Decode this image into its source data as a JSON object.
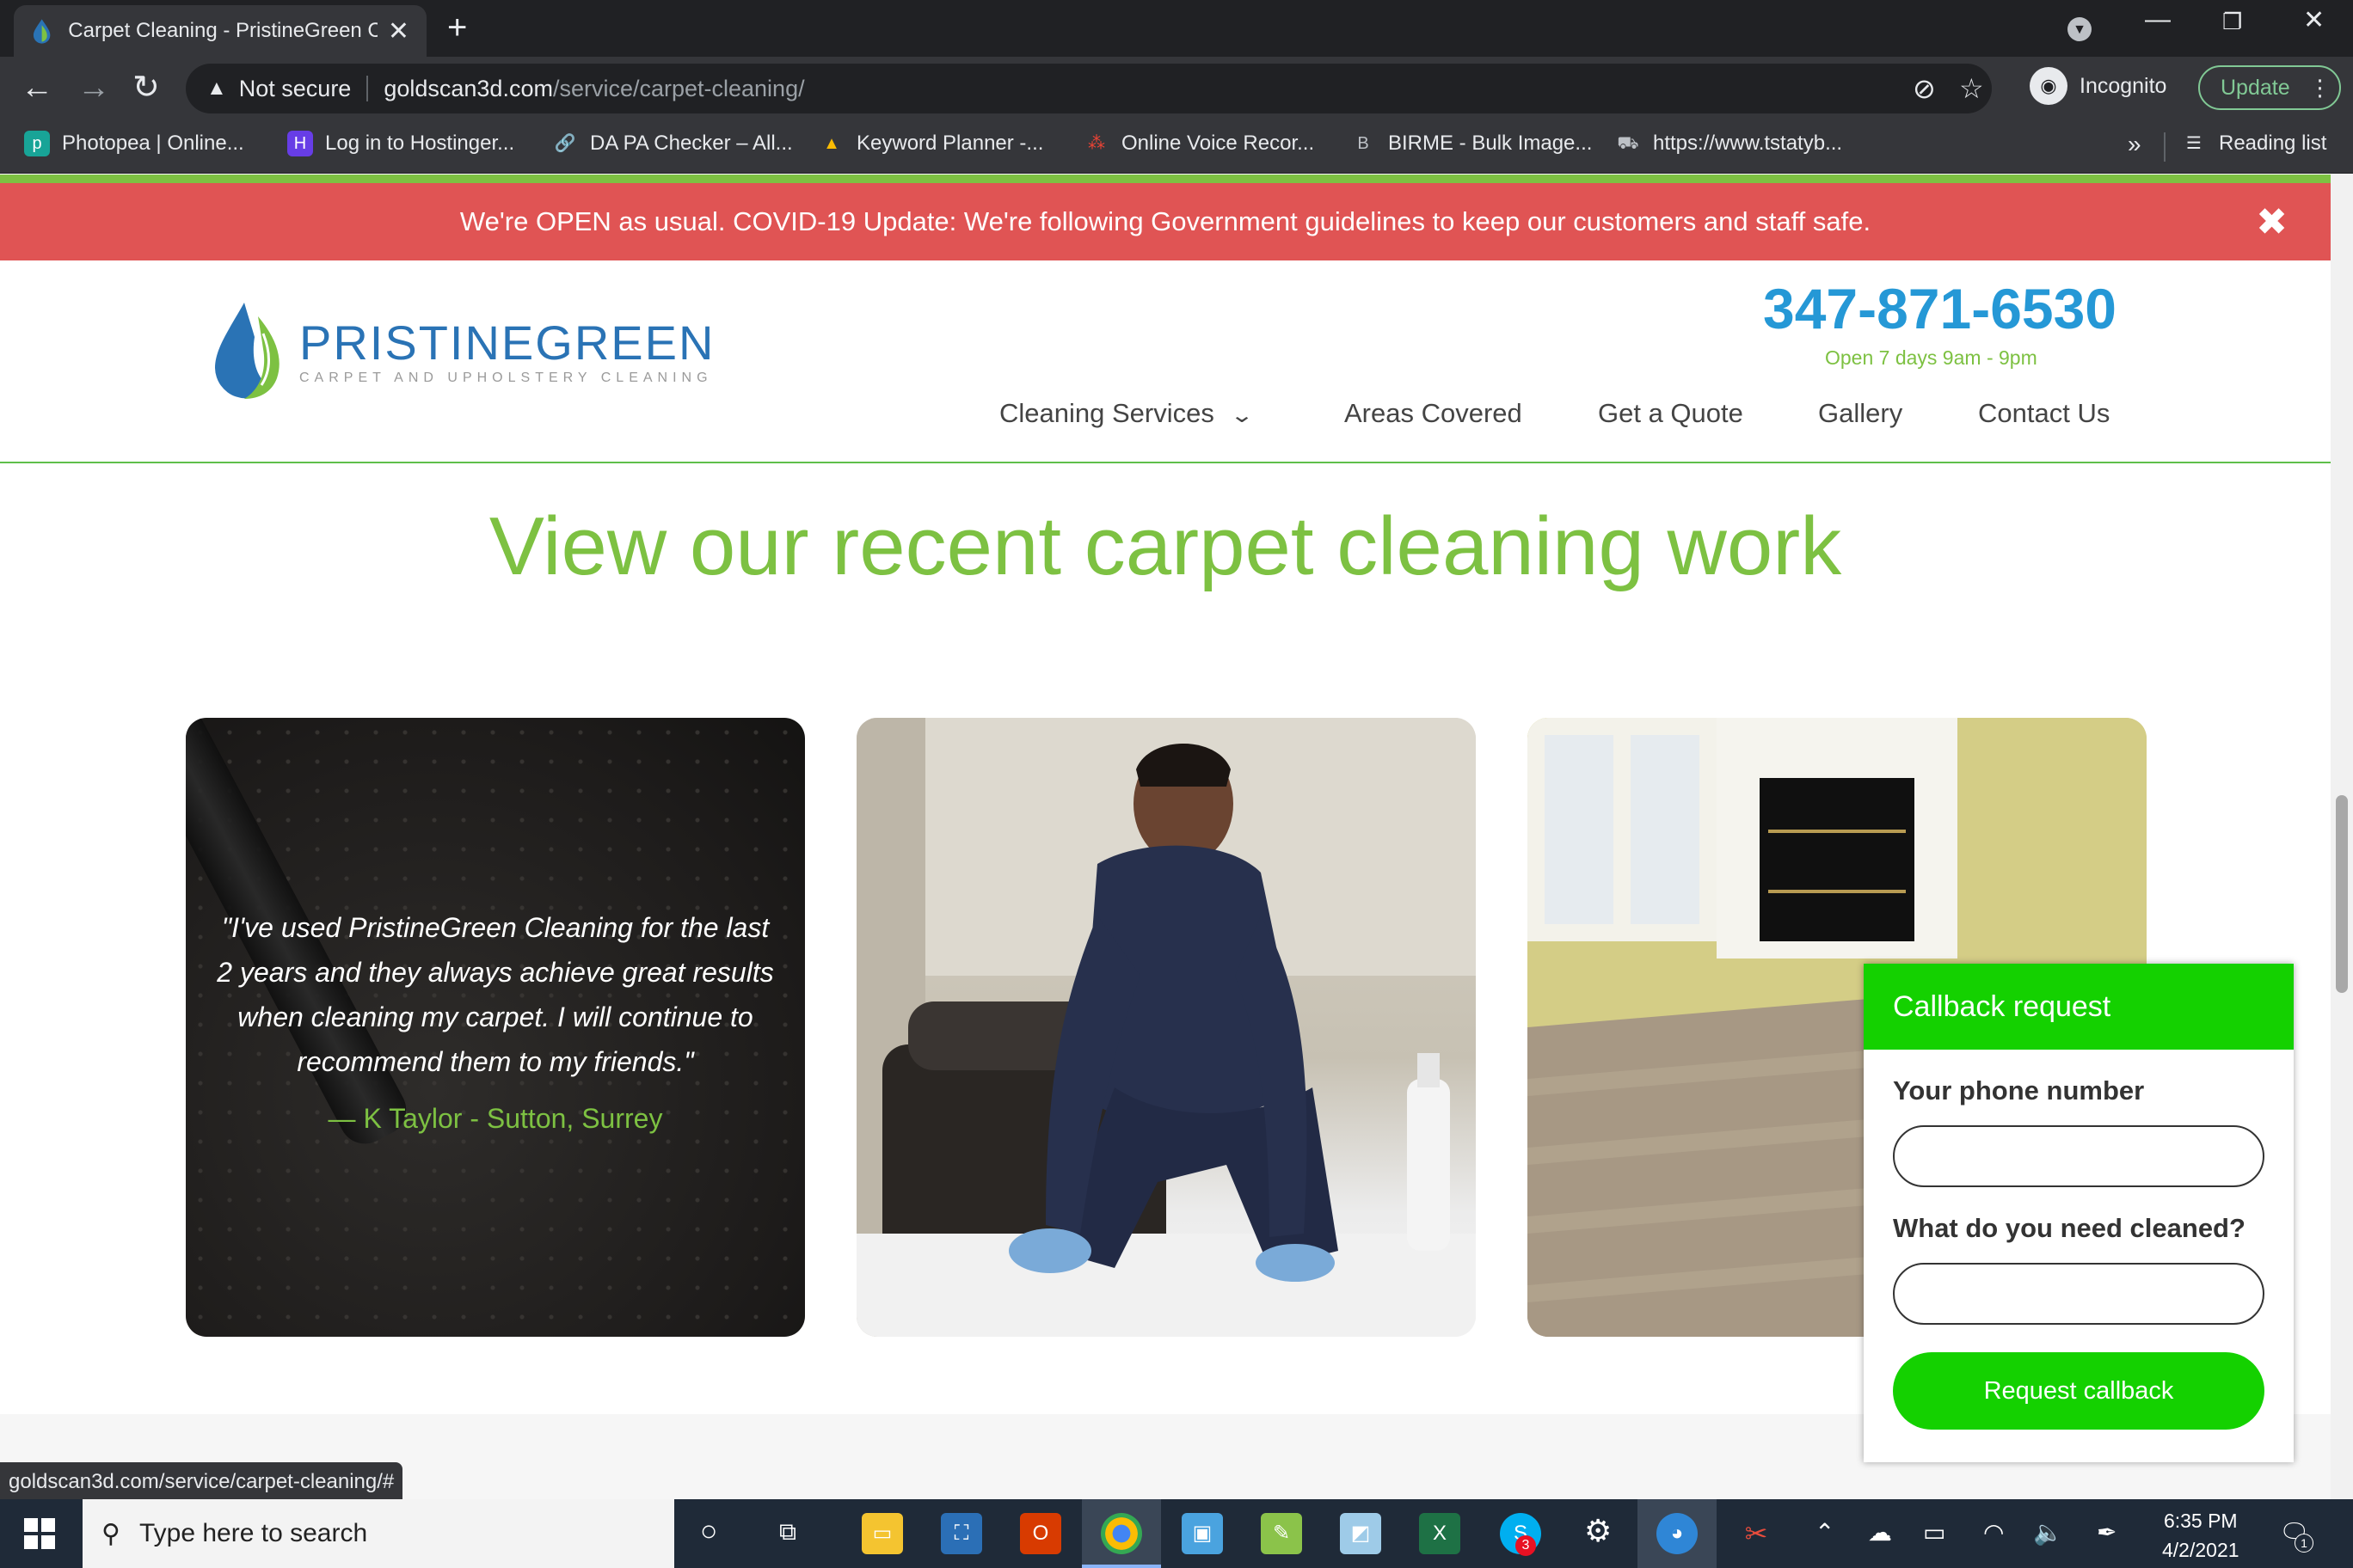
{
  "browser": {
    "tab_title": "Carpet Cleaning - PristineGreen C",
    "new_tab": "+",
    "url_warning": "Not secure",
    "url_host": "goldscan3d.com",
    "url_path": "/service/carpet-cleaning/",
    "incognito_label": "Incognito",
    "update_label": "Update",
    "bookmarks": [
      {
        "label": "Photopea | Online...",
        "icon": "photopea-icon",
        "color": "#18a497"
      },
      {
        "label": "Log in to Hostinger...",
        "icon": "hostinger-icon",
        "color": "#673de6"
      },
      {
        "label": "DA PA Checker – All...",
        "icon": "link-icon",
        "color": "#4e8cdb"
      },
      {
        "label": "Keyword Planner -...",
        "icon": "google-ads-icon",
        "color": "#fbbc04"
      },
      {
        "label": "Online Voice Recor...",
        "icon": "voice-recorder-icon",
        "color": "#ea4335"
      },
      {
        "label": "BIRME - Bulk Image...",
        "icon": "birme-icon",
        "color": "#5f6368"
      },
      {
        "label": "https://www.tstatyb...",
        "icon": "cart-icon",
        "color": "#5f6368"
      }
    ],
    "bookmarks_more": "»",
    "reading_list": "Reading list"
  },
  "banner": {
    "text": "We're OPEN as usual. COVID-19 Update: We're following Government guidelines to keep our customers and staff safe.",
    "close": "✖"
  },
  "header": {
    "brand_name": "PRISTINEGREEN",
    "brand_tagline": "CARPET AND UPHOLSTERY CLEANING",
    "phone": "347-871-6530",
    "hours": "Open 7 days 9am - 9pm",
    "nav": [
      "Cleaning Services",
      "Areas Covered",
      "Get a Quote",
      "Gallery",
      "Contact Us"
    ]
  },
  "main": {
    "title": "View our recent carpet cleaning work",
    "quote": "\"I've used PristineGreen Cleaning for the last 2 years and they always achieve great results when cleaning my carpet. I will continue to recommend them to my friends.\"",
    "quote_author": "— K Taylor - Sutton, Surrey"
  },
  "callback": {
    "title": "Callback request",
    "phone_label": "Your phone number",
    "clean_label": "What do you need cleaned?",
    "button": "Request callback"
  },
  "status_url": "goldscan3d.com/service/carpet-cleaning/#",
  "taskbar": {
    "search_placeholder": "Type here to search",
    "time": "6:35 PM",
    "date": "4/2/2021",
    "skype_badge": "3",
    "notification_badge": "1"
  },
  "colors": {
    "brand_green": "#7dc142",
    "brand_blue": "#2598d6",
    "banner_red": "#e05454",
    "callback_green": "#14d100"
  }
}
